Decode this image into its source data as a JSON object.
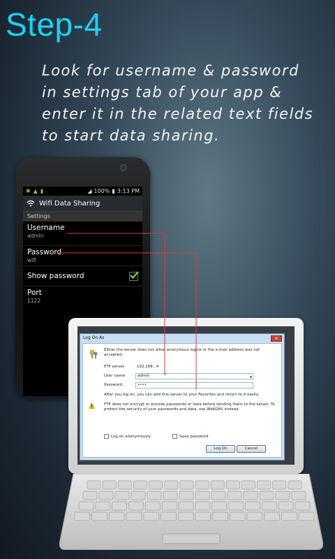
{
  "step": {
    "title": "Step-4"
  },
  "instructions": {
    "line1": "Look for username & password",
    "line2": "in settings tab of your app &",
    "line3": "enter it in the related text fields",
    "line4": "to start data sharing."
  },
  "phone": {
    "status_time": "3:13 PM",
    "status_battery": "100%",
    "app_title": "Wifi Data Sharing",
    "section": "Settings",
    "prefs": {
      "username": {
        "title": "Username",
        "value": "admin"
      },
      "password": {
        "title": "Password",
        "value": "wifi"
      },
      "show_password": {
        "title": "Show password",
        "checked": true
      },
      "port": {
        "title": "Port",
        "value": "1122"
      }
    }
  },
  "dialog": {
    "title": "Log On As",
    "message": "Either the server does not allow anonymous logins or the e-mail address was not accepted.",
    "ftp_label": "FTP server:",
    "ftp_value": "192.168...4",
    "user_label": "User name:",
    "user_value": "admin",
    "pass_label": "Password:",
    "pass_value": "••••",
    "info": "After you log on, you can add this server to your Favorites and return to it easily.",
    "warning": "FTP does not encrypt or encode passwords or data before sending them to the server.  To protect the security of your passwords and data, use WebDAV instead.",
    "anon_label": "Log on anonymously",
    "save_label": "Save password",
    "logon_label": "Log On",
    "cancel_label": "Cancel"
  },
  "colors": {
    "accent": "#19d3f6",
    "line": "#e03a3a"
  }
}
